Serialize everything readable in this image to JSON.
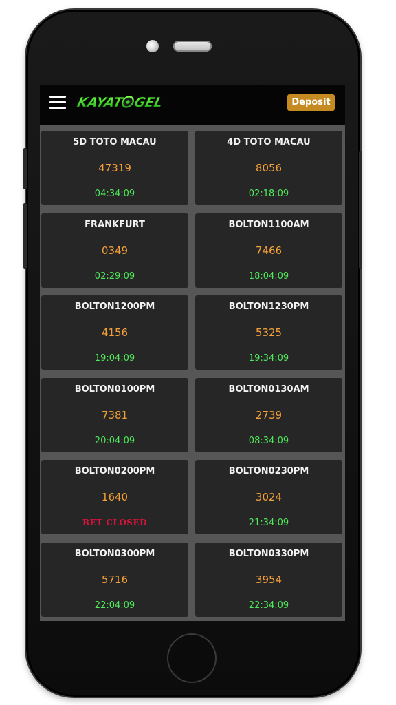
{
  "header": {
    "logo_text": "KAYATOGEL",
    "deposit_label": "Deposit"
  },
  "colors": {
    "accent": "#c68a22",
    "result": "#f4a03a",
    "timer": "#4fe85a",
    "closed": "#d8143c",
    "card_bg": "#262626",
    "page_bg": "#565656",
    "logo_green": "#39d627"
  },
  "icons": {
    "menu": "hamburger-menu-icon"
  },
  "markets": [
    {
      "name": "5D TOTO MACAU",
      "result": "47319",
      "status": "04:34:09",
      "closed": false
    },
    {
      "name": "4D TOTO MACAU",
      "result": "8056",
      "status": "02:18:09",
      "closed": false
    },
    {
      "name": "FRANKFURT",
      "result": "0349",
      "status": "02:29:09",
      "closed": false
    },
    {
      "name": "BOLTON1100AM",
      "result": "7466",
      "status": "18:04:09",
      "closed": false
    },
    {
      "name": "BOLTON1200PM",
      "result": "4156",
      "status": "19:04:09",
      "closed": false
    },
    {
      "name": "BOLTON1230PM",
      "result": "5325",
      "status": "19:34:09",
      "closed": false
    },
    {
      "name": "BOLTON0100PM",
      "result": "7381",
      "status": "20:04:09",
      "closed": false
    },
    {
      "name": "BOLTON0130AM",
      "result": "2739",
      "status": "08:34:09",
      "closed": false
    },
    {
      "name": "BOLTON0200PM",
      "result": "1640",
      "status": "BET CLOSED",
      "closed": true
    },
    {
      "name": "BOLTON0230PM",
      "result": "3024",
      "status": "21:34:09",
      "closed": false
    },
    {
      "name": "BOLTON0300PM",
      "result": "5716",
      "status": "22:04:09",
      "closed": false
    },
    {
      "name": "BOLTON0330PM",
      "result": "3954",
      "status": "22:34:09",
      "closed": false
    }
  ]
}
